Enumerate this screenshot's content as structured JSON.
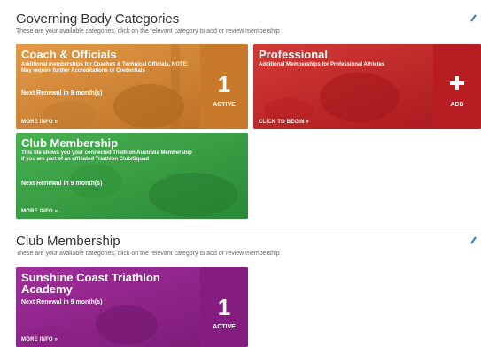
{
  "governing": {
    "title": "Governing Body Categories",
    "subtitle": "These are your available categories, click on the relevant category to add or review membership",
    "tiles": {
      "coach": {
        "title": "Coach & Officials",
        "description": "Additional memberships for Coaches & Technical Officials. NOTE: May require further Accreditations or Credentials",
        "renewal": "Next Renewal in 9 month(s)",
        "more": "MORE INFO »",
        "count": "1",
        "status": "ACTIVE",
        "color": "#d98a35"
      },
      "professional": {
        "title": "Professional",
        "description": "Additional Memberships for Professional Athletes",
        "action": "CLICK TO BEGIN »",
        "side_label": "ADD",
        "color": "#c8232a"
      },
      "club": {
        "title": "Club Membership",
        "description": "This tile shows you your connected Triathlon Australia Membership if you are part of an affiliated Triathlon Club/Squad",
        "renewal": "Next Renewal in 9 month(s)",
        "more": "MORE INFO »",
        "color": "#3aa346"
      }
    }
  },
  "club_section": {
    "title": "Club Membership",
    "subtitle": "These are your available categories, click on the relevant category to add or review membership",
    "tiles": {
      "sunshine": {
        "title": "Sunshine Coast Triathlon Academy",
        "renewal": "Next Renewal in 9 month(s)",
        "more": "MORE INFO »",
        "count": "1",
        "status": "ACTIVE",
        "color": "#93218d"
      }
    }
  },
  "icons": {
    "collapse": "chevron-up-icon",
    "add": "plus-icon"
  }
}
